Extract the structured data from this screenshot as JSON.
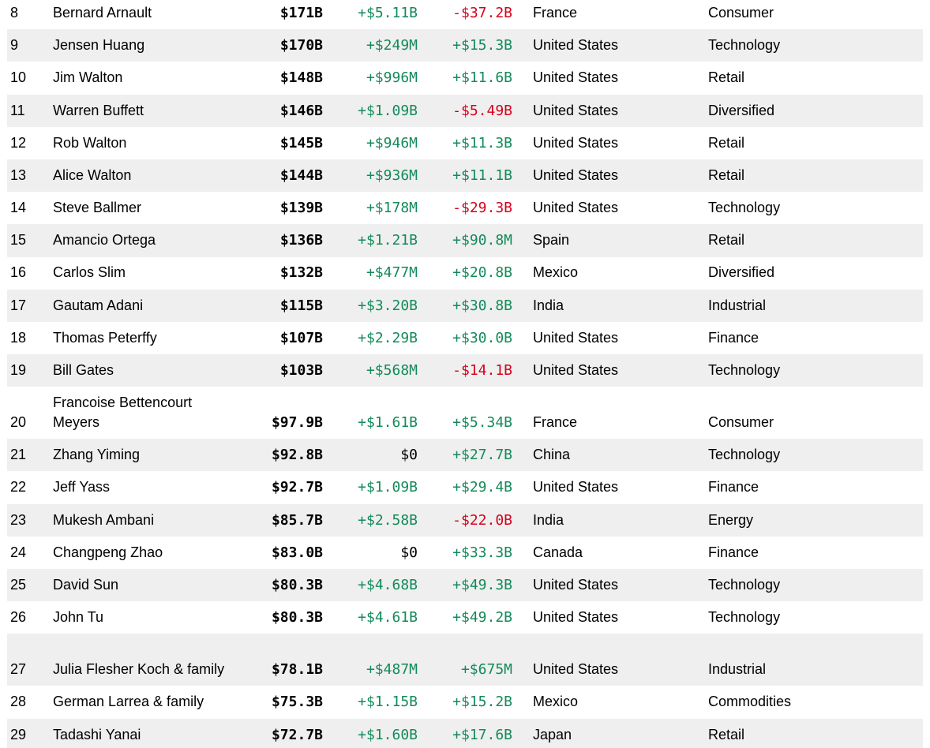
{
  "colors": {
    "positive": "#138a5a",
    "negative": "#d6001c",
    "stripe": "#efefef"
  },
  "rows": [
    {
      "rank": "8",
      "name": "Bernard Arnault",
      "worth": "$171B",
      "change": "+$5.11B",
      "ytd": "-$37.2B",
      "country": "France",
      "industry": "Consumer"
    },
    {
      "rank": "9",
      "name": "Jensen Huang",
      "worth": "$170B",
      "change": "+$249M",
      "ytd": "+$15.3B",
      "country": "United States",
      "industry": "Technology"
    },
    {
      "rank": "10",
      "name": "Jim Walton",
      "worth": "$148B",
      "change": "+$996M",
      "ytd": "+$11.6B",
      "country": "United States",
      "industry": "Retail"
    },
    {
      "rank": "11",
      "name": "Warren Buffett",
      "worth": "$146B",
      "change": "+$1.09B",
      "ytd": "-$5.49B",
      "country": "United States",
      "industry": "Diversified"
    },
    {
      "rank": "12",
      "name": "Rob Walton",
      "worth": "$145B",
      "change": "+$946M",
      "ytd": "+$11.3B",
      "country": "United States",
      "industry": "Retail"
    },
    {
      "rank": "13",
      "name": "Alice Walton",
      "worth": "$144B",
      "change": "+$936M",
      "ytd": "+$11.1B",
      "country": "United States",
      "industry": "Retail"
    },
    {
      "rank": "14",
      "name": "Steve Ballmer",
      "worth": "$139B",
      "change": "+$178M",
      "ytd": "-$29.3B",
      "country": "United States",
      "industry": "Technology"
    },
    {
      "rank": "15",
      "name": "Amancio Ortega",
      "worth": "$136B",
      "change": "+$1.21B",
      "ytd": "+$90.8M",
      "country": "Spain",
      "industry": "Retail"
    },
    {
      "rank": "16",
      "name": "Carlos Slim",
      "worth": "$132B",
      "change": "+$477M",
      "ytd": "+$20.8B",
      "country": "Mexico",
      "industry": "Diversified"
    },
    {
      "rank": "17",
      "name": "Gautam Adani",
      "worth": "$115B",
      "change": "+$3.20B",
      "ytd": "+$30.8B",
      "country": "India",
      "industry": "Industrial"
    },
    {
      "rank": "18",
      "name": "Thomas Peterffy",
      "worth": "$107B",
      "change": "+$2.29B",
      "ytd": "+$30.0B",
      "country": "United States",
      "industry": "Finance"
    },
    {
      "rank": "19",
      "name": "Bill Gates",
      "worth": "$103B",
      "change": "+$568M",
      "ytd": "-$14.1B",
      "country": "United States",
      "industry": "Technology"
    },
    {
      "rank": "20",
      "name": "Francoise Bettencourt Meyers",
      "worth": "$97.9B",
      "change": "+$1.61B",
      "ytd": "+$5.34B",
      "country": "France",
      "industry": "Consumer"
    },
    {
      "rank": "21",
      "name": "Zhang Yiming",
      "worth": "$92.8B",
      "change": "$0",
      "ytd": "+$27.7B",
      "country": "China",
      "industry": "Technology"
    },
    {
      "rank": "22",
      "name": "Jeff Yass",
      "worth": "$92.7B",
      "change": "+$1.09B",
      "ytd": "+$29.4B",
      "country": "United States",
      "industry": "Finance"
    },
    {
      "rank": "23",
      "name": "Mukesh Ambani",
      "worth": "$85.7B",
      "change": "+$2.58B",
      "ytd": "-$22.0B",
      "country": "India",
      "industry": "Energy"
    },
    {
      "rank": "24",
      "name": "Changpeng Zhao",
      "worth": "$83.0B",
      "change": "$0",
      "ytd": "+$33.3B",
      "country": "Canada",
      "industry": "Finance"
    },
    {
      "rank": "25",
      "name": "David Sun",
      "worth": "$80.3B",
      "change": "+$4.68B",
      "ytd": "+$49.3B",
      "country": "United States",
      "industry": "Technology"
    },
    {
      "rank": "26",
      "name": "John Tu",
      "worth": "$80.3B",
      "change": "+$4.61B",
      "ytd": "+$49.2B",
      "country": "United States",
      "industry": "Technology"
    },
    {
      "rank": "27",
      "name": "Julia Flesher Koch & family",
      "worth": "$78.1B",
      "change": "+$487M",
      "ytd": "+$675M",
      "country": "United States",
      "industry": "Industrial"
    },
    {
      "rank": "28",
      "name": "German Larrea & family",
      "worth": "$75.3B",
      "change": "+$1.15B",
      "ytd": "+$15.2B",
      "country": "Mexico",
      "industry": "Commodities"
    },
    {
      "rank": "29",
      "name": "Tadashi Yanai",
      "worth": "$72.7B",
      "change": "+$1.60B",
      "ytd": "+$17.6B",
      "country": "Japan",
      "industry": "Retail"
    }
  ]
}
